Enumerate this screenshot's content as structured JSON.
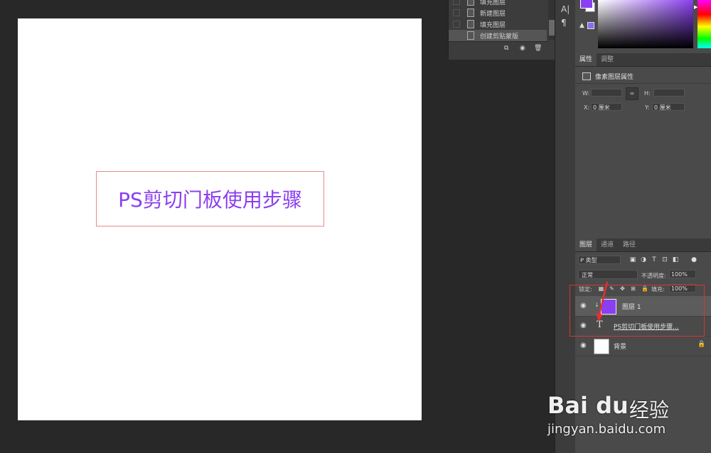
{
  "canvas": {
    "text_layer_content": "PS剪切门板使用步骤",
    "text_color": "#8a3ff0"
  },
  "history": {
    "items": [
      {
        "label": "填充图层",
        "active": false
      },
      {
        "label": "新建图层",
        "active": false
      },
      {
        "label": "填充图层",
        "active": false
      },
      {
        "label": "创建剪贴蒙版",
        "active": true
      }
    ]
  },
  "strip": {
    "char_icon": "A|",
    "para_icon": "¶"
  },
  "color": {
    "foreground": "#8a3ff0",
    "background": "#ffffff",
    "warning_icon": "▲"
  },
  "properties": {
    "tabs": [
      "属性",
      "调整"
    ],
    "title": "像素图层属性",
    "w_label": "W:",
    "w_value": "",
    "h_label": "H:",
    "h_value": "",
    "x_label": "X:",
    "x_value": "0 厘米",
    "y_label": "Y:",
    "y_value": "0 厘米",
    "link_icon": "∞"
  },
  "layers": {
    "tabs": [
      "图层",
      "通道",
      "路径"
    ],
    "filter_label": "ᑭ 类型",
    "blend_mode": "正常",
    "opacity_label": "不透明度:",
    "opacity_value": "100%",
    "lock_label": "锁定:",
    "fill_label": "填充:",
    "fill_value": "100%",
    "items": [
      {
        "name": "图层 1",
        "type": "pixel",
        "selected": true,
        "thumb_color": "#8a3ff0"
      },
      {
        "name": "PS剪切门板使用步骤...",
        "type": "text",
        "selected": false
      },
      {
        "name": "背景",
        "type": "background",
        "selected": false,
        "thumb_color": "#ffffff"
      }
    ]
  },
  "watermark": {
    "logo": "Bai du",
    "jingyan": "经验",
    "url": "jingyan.baidu.com"
  }
}
